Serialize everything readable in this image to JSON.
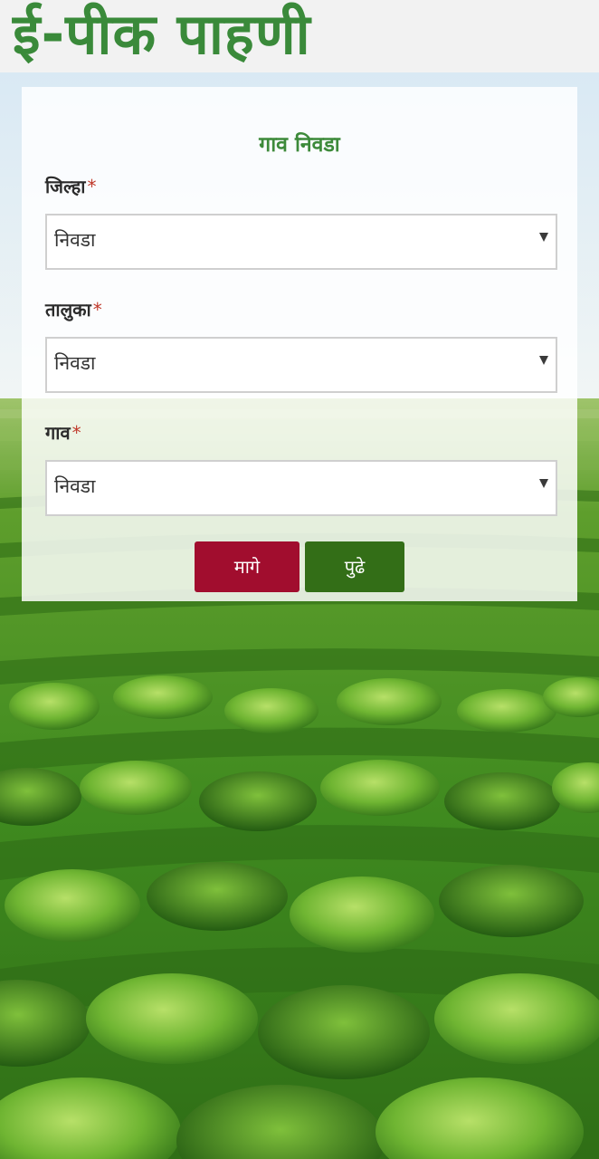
{
  "header": {
    "title": "ई-पीक पाहणी"
  },
  "form": {
    "title": "गाव निवडा",
    "fields": [
      {
        "label": "जिल्हा",
        "required_mark": "*",
        "value": "निवडा"
      },
      {
        "label": "तालुका",
        "required_mark": "*",
        "value": "निवडा"
      },
      {
        "label": "गाव",
        "required_mark": "*",
        "value": "निवडा"
      }
    ],
    "buttons": {
      "back": "मागे",
      "next": "पुढे"
    }
  },
  "colors": {
    "title_green": "#3a8a3a",
    "back_button": "#a10d2e",
    "next_button": "#336e17",
    "required": "#c0392b"
  },
  "icons": {
    "dropdown": "chevron-down-icon"
  }
}
